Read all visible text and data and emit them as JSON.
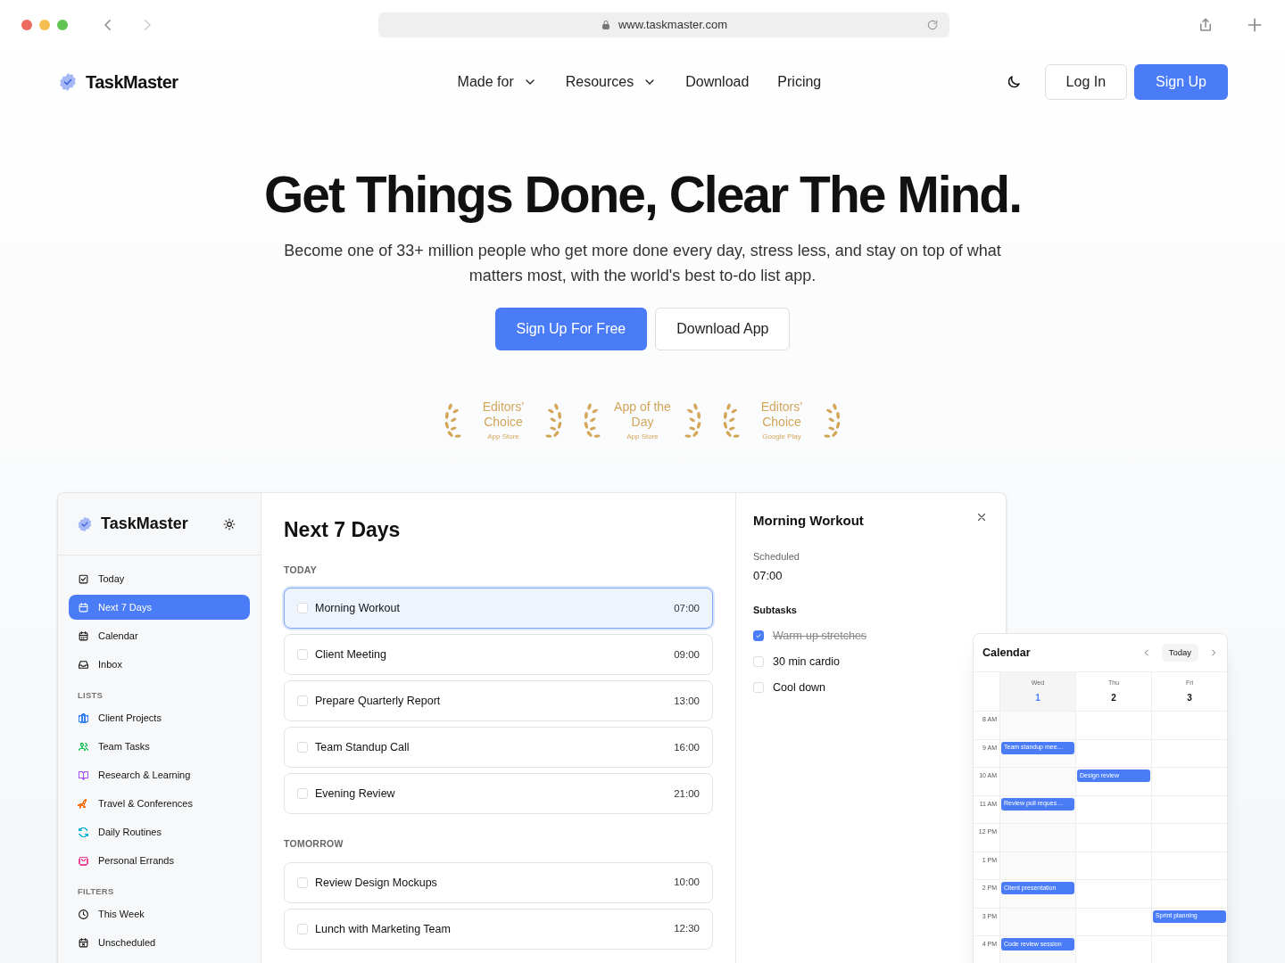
{
  "browser": {
    "url": "www.taskmaster.com"
  },
  "nav": {
    "logo": "TaskMaster",
    "links": [
      {
        "label": "Made for",
        "dropdown": true
      },
      {
        "label": "Resources",
        "dropdown": true
      },
      {
        "label": "Download",
        "dropdown": false
      },
      {
        "label": "Pricing",
        "dropdown": false
      }
    ],
    "log_in": "Log In",
    "sign_up": "Sign Up"
  },
  "hero": {
    "title": "Get Things Done, Clear The Mind.",
    "subtitle": "Become one of 33+ million people who get more done every day, stress less, and stay on top of what matters most, with the world's best to-do list app.",
    "primary_button": "Sign Up For Free",
    "secondary_button": "Download App"
  },
  "awards": [
    {
      "title": "Editors’ Choice",
      "source": "App Store"
    },
    {
      "title": "App of the Day",
      "source": "App Store"
    },
    {
      "title": "Editors’ Choice",
      "source": "Google Play"
    }
  ],
  "app": {
    "sidebar": {
      "logo": "TaskMaster",
      "items": [
        {
          "label": "Today",
          "selected": false
        },
        {
          "label": "Next 7 Days",
          "selected": true
        },
        {
          "label": "Calendar",
          "selected": false
        },
        {
          "label": "Inbox",
          "selected": false
        }
      ],
      "lists_heading": "LISTS",
      "lists": [
        {
          "label": "Client Projects",
          "color": "#3b82f6"
        },
        {
          "label": "Team Tasks",
          "color": "#22c55e"
        },
        {
          "label": "Research & Learning",
          "color": "#a855f7"
        },
        {
          "label": "Travel & Conferences",
          "color": "#f97316"
        },
        {
          "label": "Daily Routines",
          "color": "#06b6d4"
        },
        {
          "label": "Personal Errands",
          "color": "#ec4899"
        }
      ],
      "filters_heading": "FILTERS",
      "filters": [
        {
          "label": "This Week"
        },
        {
          "label": "Unscheduled"
        }
      ]
    },
    "main": {
      "title": "Next 7 Days",
      "groups": [
        {
          "heading": "TODAY",
          "tasks": [
            {
              "title": "Morning Workout",
              "time": "07:00",
              "selected": true,
              "checked": false
            },
            {
              "title": "Client Meeting",
              "time": "09:00",
              "selected": false,
              "checked": false
            },
            {
              "title": "Prepare Quarterly Report",
              "time": "13:00",
              "selected": false,
              "checked": false
            },
            {
              "title": "Team Standup Call",
              "time": "16:00",
              "selected": false,
              "checked": false
            },
            {
              "title": "Evening Review",
              "time": "21:00",
              "selected": false,
              "checked": false
            }
          ]
        },
        {
          "heading": "TOMORROW",
          "tasks": [
            {
              "title": "Review Design Mockups",
              "time": "10:00",
              "selected": false,
              "checked": false
            },
            {
              "title": "Lunch with Marketing Team",
              "time": "12:30",
              "selected": false,
              "checked": false
            }
          ]
        }
      ]
    },
    "details": {
      "title": "Morning Workout",
      "scheduled_label": "Scheduled",
      "scheduled_value": "07:00",
      "subtasks_label": "Subtasks",
      "subtasks": [
        {
          "label": "Warm-up stretches",
          "checked": true
        },
        {
          "label": "30 min cardio",
          "checked": false
        },
        {
          "label": "Cool down",
          "checked": false
        }
      ]
    },
    "calendar": {
      "title": "Calendar",
      "today_button": "Today",
      "days": [
        {
          "weekday": "Wed",
          "date": "1",
          "selected": true
        },
        {
          "weekday": "Thu",
          "date": "2",
          "selected": false
        },
        {
          "weekday": "Fri",
          "date": "3",
          "selected": false
        }
      ],
      "rows": [
        {
          "time": "8 AM"
        },
        {
          "time": "9 AM",
          "column_1": "Team standup mee…"
        },
        {
          "time": "10 AM",
          "column_2": "Design review"
        },
        {
          "time": "11 AM",
          "column_1": "Review pull reques…"
        },
        {
          "time": "12 PM"
        },
        {
          "time": "1 PM"
        },
        {
          "time": "2 PM",
          "column_1": "Client presentation"
        },
        {
          "time": "3 PM",
          "column_3": "Sprint planning"
        },
        {
          "time": "4 PM",
          "column_1": "Code review session"
        }
      ]
    }
  }
}
